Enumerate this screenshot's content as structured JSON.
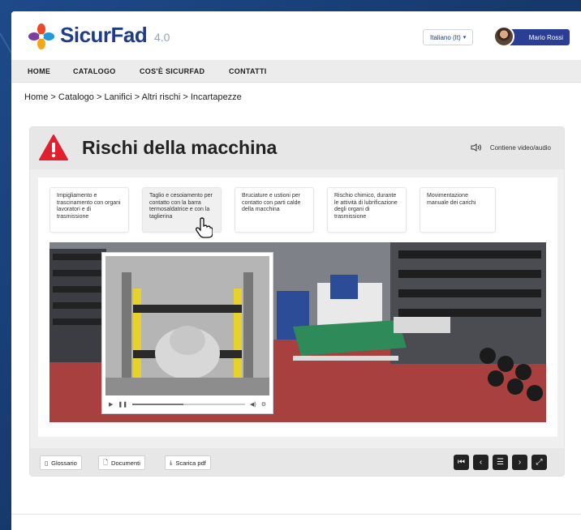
{
  "header": {
    "logo_text": "SicurFad",
    "logo_version": "4.0",
    "language": "Italiano (It)",
    "user_name": "Mario Rossi"
  },
  "nav": {
    "items": [
      "HOME",
      "CATALOGO",
      "COS'È SICURFAD",
      "CONTATTI"
    ]
  },
  "breadcrumb": "Home > Catalogo > Lanifici > Altri rischi > Incartapezze",
  "module": {
    "title": "Rischi della macchina",
    "media_note": "Contiene video/audio",
    "tabs": [
      {
        "label": "Impigliamento e trascinamento con organi lavoratori e di trasmissione",
        "active": false
      },
      {
        "label": "Taglio e cesoiamento per contatto con la barra termosaldatrice e con la taglierina",
        "active": true
      },
      {
        "label": "Bruciature e ustioni per contatto con parti calde della macchina",
        "active": false
      },
      {
        "label": "Rischio chimico, durante le attività di lubrificazione degli organi di trasmissione",
        "active": false
      },
      {
        "label": "Movimentazione manuale dei carichi",
        "active": false
      }
    ],
    "video_progress": 0.45
  },
  "footer": {
    "glossary": "Glossario",
    "documents": "Documenti",
    "download_pdf": "Scarica pdf"
  },
  "colors": {
    "brand_blue": "#1f3b8c",
    "warning_red": "#e0202f",
    "background": "#1e4a8a"
  }
}
